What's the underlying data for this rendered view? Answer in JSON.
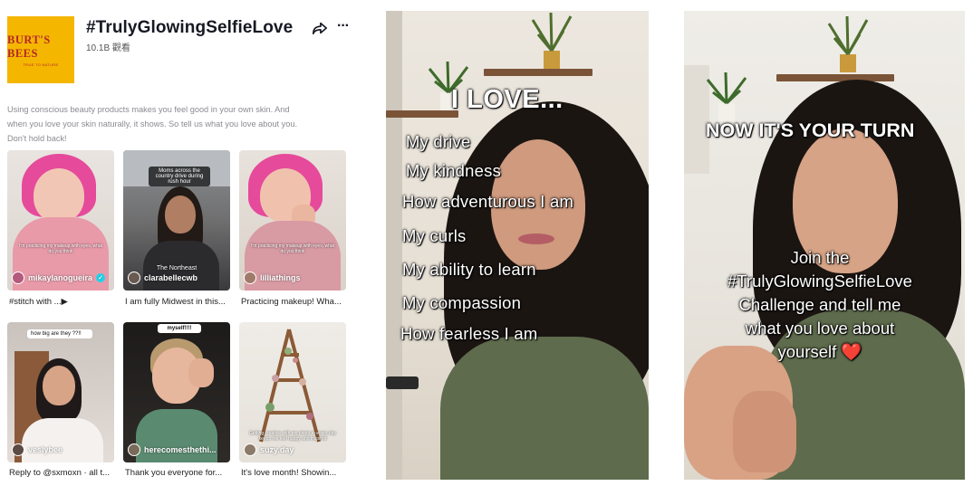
{
  "brand": {
    "logo_name": "BURT'S BEES",
    "logo_tagline": "TRUE TO NATURE",
    "logo_color": "#f5b600"
  },
  "header": {
    "title": "#TrulyGlowingSelfieLove",
    "views": "10.1B 觀看",
    "share_icon": "share-arrow-icon",
    "more_icon": "more-dots-icon",
    "more_label": "···"
  },
  "description": "Using conscious beauty products makes you feel good in your own skin. And when you love your skin naturally, it shows. So tell us what you love about you. Don't hold back!",
  "videos": [
    {
      "username": "mikaylanogueira",
      "verified": true,
      "caption": "#stitch with ...▶",
      "overlay": "I'm practicing my makeup with eyes, what do you think"
    },
    {
      "username": "clarabellecwb",
      "verified": false,
      "caption": "I am fully Midwest in this...",
      "overlay": "Moms across the country drive during rush hour",
      "overlay2": "The Northeast"
    },
    {
      "username": "lilliathings",
      "verified": false,
      "caption": "Practicing makeup! Wha...",
      "overlay": "I'm practicing my makeup with eyes, what do you think"
    },
    {
      "username": "veslybee",
      "verified": false,
      "caption": "Reply to @sxmoxn · all t...",
      "overlay": "how big are they ??!!"
    },
    {
      "username": "herecomesthethi...",
      "verified": false,
      "caption": "Thank you everyone for...",
      "overlay": "myself!!!!"
    },
    {
      "username": "suzy.day",
      "verified": false,
      "caption": "It's love month! Showin...",
      "overlay": "Getting creative with my photo to every day keeps me feel happy and inspired"
    }
  ],
  "panel1": {
    "heading": "I LOVE...",
    "items": [
      "My drive",
      "My kindness",
      "How adventurous I am",
      "My curls",
      "My ability to learn",
      "My compassion",
      "How fearless I am"
    ]
  },
  "panel2": {
    "heading": "NOW IT'S YOUR TURN",
    "cta_lines": [
      "Join the",
      "#TrulyGlowingSelfieLove",
      "Challenge and tell me",
      "what you love about",
      "yourself ❤️"
    ]
  }
}
